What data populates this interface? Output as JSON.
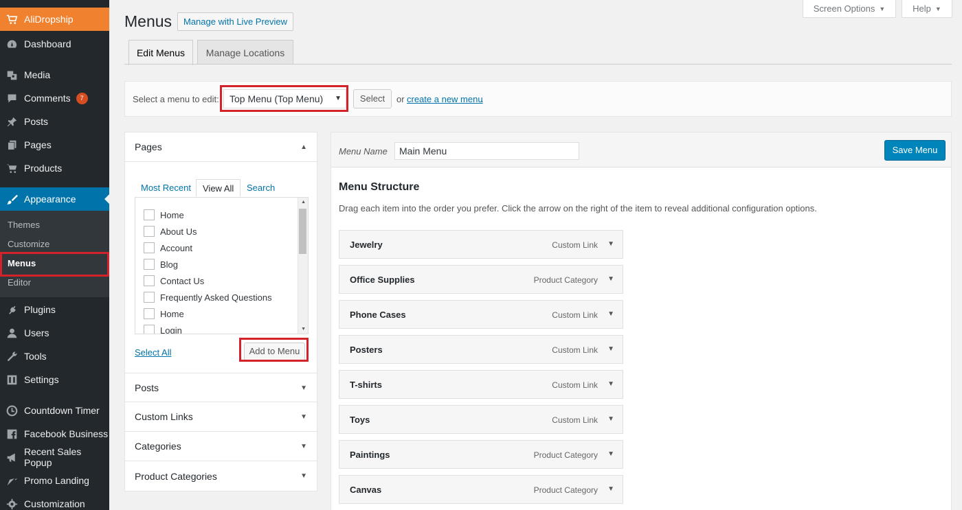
{
  "sidebar": {
    "top_item": {
      "label": "AliDropship",
      "icon": "cart-plus-icon"
    },
    "items": [
      {
        "label": "Dashboard",
        "icon": "dashboard-icon"
      },
      {
        "label": "Media",
        "icon": "media-icon"
      },
      {
        "label": "Comments",
        "icon": "comment-icon",
        "badge": "7"
      },
      {
        "label": "Posts",
        "icon": "pin-icon"
      },
      {
        "label": "Pages",
        "icon": "pages-icon"
      },
      {
        "label": "Products",
        "icon": "cart-icon"
      },
      {
        "label": "Appearance",
        "icon": "brush-icon"
      },
      {
        "label": "Plugins",
        "icon": "plug-icon"
      },
      {
        "label": "Users",
        "icon": "user-icon"
      },
      {
        "label": "Tools",
        "icon": "wrench-icon"
      },
      {
        "label": "Settings",
        "icon": "settings-icon"
      },
      {
        "label": "Countdown Timer",
        "icon": "clock-icon"
      },
      {
        "label": "Facebook Business",
        "icon": "facebook-icon"
      },
      {
        "label": "Recent Sales Popup",
        "icon": "megaphone-icon"
      },
      {
        "label": "Promo Landing",
        "icon": "carrot-icon"
      },
      {
        "label": "Customization",
        "icon": "gear-icon"
      }
    ],
    "submenu": [
      "Themes",
      "Customize",
      "Menus",
      "Editor"
    ],
    "current_submenu": "Menus"
  },
  "screen_options": {
    "label": "Screen Options"
  },
  "help": {
    "label": "Help"
  },
  "header": {
    "title": "Menus",
    "live_preview": "Manage with Live Preview"
  },
  "tabs": {
    "edit": "Edit Menus",
    "manage": "Manage Locations"
  },
  "select_bar": {
    "label": "Select a menu to edit:",
    "selected": "Top Menu (Top Menu)",
    "select_button": "Select",
    "or": "or",
    "create_link": "create a new menu",
    "dot": "."
  },
  "accordion": {
    "pages": {
      "title": "Pages",
      "tabs": [
        "Most Recent",
        "View All",
        "Search"
      ],
      "active_tab": "View All",
      "items": [
        "Home",
        "About Us",
        "Account",
        "Blog",
        "Contact Us",
        "Frequently Asked Questions",
        "Home",
        "Login"
      ],
      "select_all": "Select All",
      "add_button": "Add to Menu"
    },
    "sections": [
      "Posts",
      "Custom Links",
      "Categories",
      "Product Categories"
    ]
  },
  "editor": {
    "menu_name_label": "Menu Name",
    "menu_name_value": "Main Menu",
    "save_button": "Save Menu",
    "structure_title": "Menu Structure",
    "structure_desc": "Drag each item into the order you prefer. Click the arrow on the right of the item to reveal additional configuration options.",
    "items": [
      {
        "title": "Jewelry",
        "type": "Custom Link"
      },
      {
        "title": "Office Supplies",
        "type": "Product Category"
      },
      {
        "title": "Phone Cases",
        "type": "Custom Link"
      },
      {
        "title": "Posters",
        "type": "Custom Link"
      },
      {
        "title": "T-shirts",
        "type": "Custom Link"
      },
      {
        "title": "Toys",
        "type": "Custom Link"
      },
      {
        "title": "Paintings",
        "type": "Product Category"
      },
      {
        "title": "Canvas",
        "type": "Product Category"
      }
    ]
  },
  "colors": {
    "sidebar_bg": "#23282d",
    "accent": "#0073aa",
    "brand": "#f0812f",
    "highlight": "#d4222b",
    "primary_button": "#0085ba"
  }
}
